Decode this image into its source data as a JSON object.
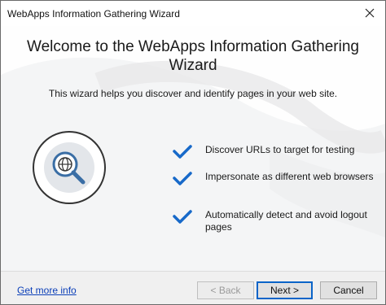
{
  "window": {
    "title": "WebApps Information Gathering Wizard",
    "close_icon": "close-icon"
  },
  "main": {
    "headline_line1": "Welcome to the WebApps Information Gathering",
    "headline_line2": "Wizard",
    "subtitle": "This wizard helps you discover and identify pages in your web site.",
    "illustration_icon": "globe-magnifier-icon",
    "features": [
      {
        "icon": "checkmark-icon",
        "text": "Discover URLs to target for testing"
      },
      {
        "icon": "checkmark-icon",
        "text": "Impersonate as different web browsers"
      },
      {
        "icon": "checkmark-icon",
        "text": "Automatically detect and avoid logout pages"
      }
    ]
  },
  "footer": {
    "help_link": "Get more info",
    "back_label": "< Back",
    "next_label": "Next >",
    "cancel_label": "Cancel"
  },
  "colors": {
    "accent_blue": "#1769c9",
    "link_blue": "#0b3fb8",
    "content_bg": "#f3f4f5",
    "footer_bg": "#f0f0f0"
  }
}
